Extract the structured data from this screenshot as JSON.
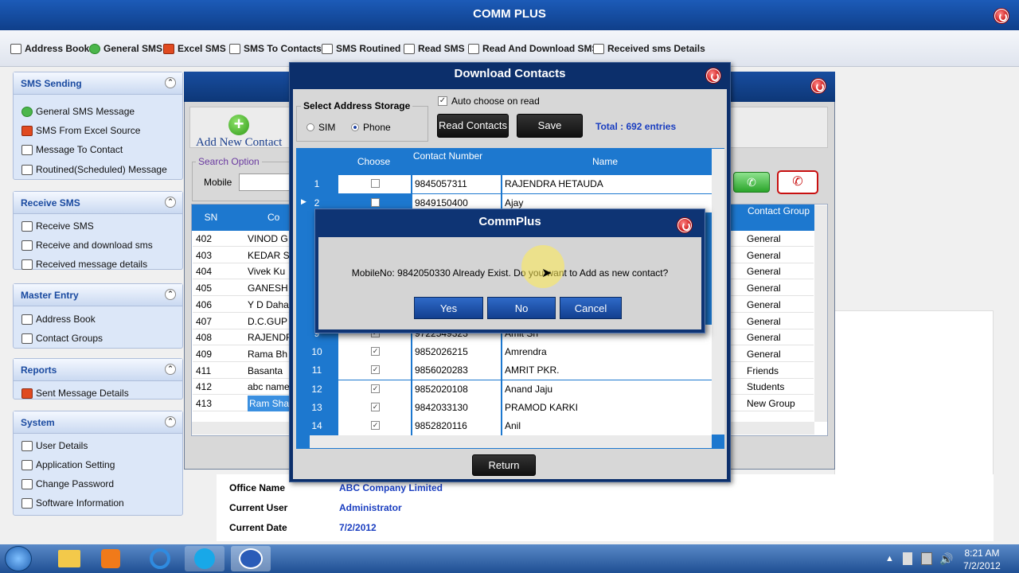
{
  "app": {
    "title": "COMM PLUS"
  },
  "toolbar": [
    {
      "label": "Address Book",
      "icon": "address-book-icon"
    },
    {
      "label": "General SMS",
      "icon": "general-sms-icon"
    },
    {
      "label": "Excel SMS",
      "icon": "excel-icon"
    },
    {
      "label": "SMS To Contacts",
      "icon": "contacts-icon"
    },
    {
      "label": "SMS Routined",
      "icon": "routine-icon"
    },
    {
      "label": "Read SMS",
      "icon": "read-sms-icon"
    },
    {
      "label": "Read And Download SMS",
      "icon": "download-icon"
    },
    {
      "label": "Received sms Details",
      "icon": "details-icon"
    }
  ],
  "sidebar": {
    "sections": [
      {
        "title": "SMS Sending",
        "items": [
          "General SMS Message",
          "SMS From Excel Source",
          "Message To Contact",
          "Routined(Scheduled) Message"
        ]
      },
      {
        "title": "Receive SMS",
        "items": [
          "Receive SMS",
          "Receive and download sms",
          "Received message details"
        ]
      },
      {
        "title": "Master Entry",
        "items": [
          "Address Book",
          "Contact Groups"
        ]
      },
      {
        "title": "Reports",
        "items": [
          "Sent Message Details"
        ]
      },
      {
        "title": "System",
        "items": [
          "User Details",
          "Application Setting",
          "Change Password",
          "Software Information"
        ]
      }
    ]
  },
  "contacts": {
    "add_label": "Add New Contact",
    "search_group": "Search Option",
    "mobile_label": "Mobile",
    "mobile_value": "",
    "col_sn": "SN",
    "col_name": "Co",
    "col_group": "Contact Group",
    "rows": [
      {
        "sn": "402",
        "name": "VINOD G",
        "group": "General"
      },
      {
        "sn": "403",
        "name": "KEDAR S",
        "group": "General"
      },
      {
        "sn": "404",
        "name": "Vivek Ku",
        "group": "General"
      },
      {
        "sn": "405",
        "name": "GANESH",
        "group": "General"
      },
      {
        "sn": "406",
        "name": "Y D Daha",
        "group": "General"
      },
      {
        "sn": "407",
        "name": "D.C.GUP",
        "group": "General"
      },
      {
        "sn": "408",
        "name": "RAJENDR",
        "group": "General"
      },
      {
        "sn": "409",
        "name": "Rama Bh",
        "group": "General"
      },
      {
        "sn": "411",
        "name": "Basanta",
        "group": "Friends"
      },
      {
        "sn": "412",
        "name": "abc name",
        "group": "Students"
      },
      {
        "sn": "413",
        "name": "Ram Sha",
        "group": "New Group"
      }
    ]
  },
  "info": {
    "office_label": "Office Name",
    "office_value": "ABC Company Limited",
    "user_label": "Current User",
    "user_value": "Administrator",
    "date_label": "Current Date",
    "date_value": "7/2/2012"
  },
  "download": {
    "title": "Download Contacts",
    "storage_label": "Select Address Storage",
    "sim_label": "SIM",
    "phone_label": "Phone",
    "auto_label": "Auto choose on read",
    "read_btn": "Read Contacts",
    "save_btn": "Save",
    "total": "Total : 692 entries",
    "col_choose": "Choose",
    "col_number": "Contact Number",
    "col_name": "Name",
    "return_btn": "Return",
    "rows": [
      {
        "sn": "1",
        "checked": false,
        "number": "9845057311",
        "name": "RAJENDRA HETAUDA"
      },
      {
        "sn": "2",
        "checked": false,
        "number": "9849150400",
        "name": "Ajay"
      },
      {
        "sn": "9",
        "checked": true,
        "number": "9722549323",
        "name": "Amit Sh"
      },
      {
        "sn": "10",
        "checked": true,
        "number": "9852026215",
        "name": "Amrendra"
      },
      {
        "sn": "11",
        "checked": true,
        "number": "9856020283",
        "name": "AMRIT PKR."
      },
      {
        "sn": "12",
        "checked": true,
        "number": "9852020108",
        "name": "Anand Jaju"
      },
      {
        "sn": "13",
        "checked": true,
        "number": "9842033130",
        "name": "PRAMOD KARKI"
      },
      {
        "sn": "14",
        "checked": true,
        "number": "9852820116",
        "name": "Anil"
      }
    ]
  },
  "dialog": {
    "title": "CommPlus",
    "message": "MobileNo: 9842050330 Already Exist. Do you want to Add as new contact?",
    "yes": "Yes",
    "no": "No",
    "cancel": "Cancel"
  },
  "taskbar": {
    "time": "8:21 AM",
    "date": "7/2/2012"
  },
  "colors": {
    "accent": "#1d78cf",
    "title_bar": "#0f3f8a",
    "close": "#c81010"
  }
}
